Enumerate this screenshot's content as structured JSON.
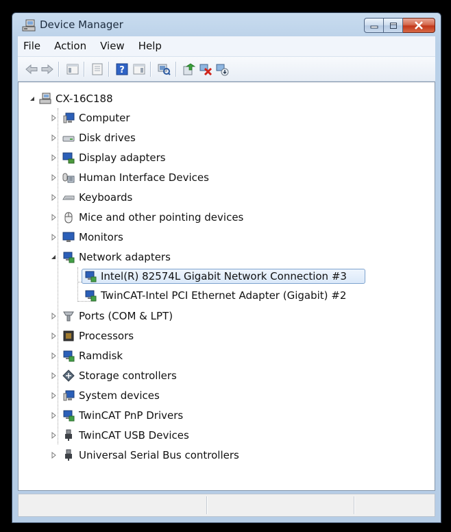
{
  "window": {
    "title": "Device Manager",
    "icon": "device-manager-icon"
  },
  "menu": [
    "File",
    "Action",
    "View",
    "Help"
  ],
  "toolbar": [
    "back-icon",
    "forward-icon",
    "show-hide-console-tree-icon",
    "properties-icon",
    "help-icon",
    "show-hide-action-pane-icon",
    "scan-hardware-changes-icon",
    "update-driver-icon",
    "uninstall-icon",
    "disable-icon"
  ],
  "tree": {
    "root": "CX-16C188",
    "categories": [
      {
        "label": "Computer",
        "icon": "computer-icon"
      },
      {
        "label": "Disk drives",
        "icon": "disk-drive-icon"
      },
      {
        "label": "Display adapters",
        "icon": "display-adapter-icon"
      },
      {
        "label": "Human Interface Devices",
        "icon": "hid-icon"
      },
      {
        "label": "Keyboards",
        "icon": "keyboard-icon"
      },
      {
        "label": "Mice and other pointing devices",
        "icon": "mouse-icon"
      },
      {
        "label": "Monitors",
        "icon": "monitor-icon"
      },
      {
        "label": "Network adapters",
        "icon": "network-adapter-icon"
      },
      {
        "label": "Ports (COM & LPT)",
        "icon": "port-icon"
      },
      {
        "label": "Processors",
        "icon": "processor-icon"
      },
      {
        "label": "Ramdisk",
        "icon": "ramdisk-icon"
      },
      {
        "label": "Storage controllers",
        "icon": "storage-controller-icon"
      },
      {
        "label": "System devices",
        "icon": "system-devices-icon"
      },
      {
        "label": "TwinCAT PnP Drivers",
        "icon": "twincat-pnp-icon"
      },
      {
        "label": "TwinCAT USB Devices",
        "icon": "usb-plug-icon"
      },
      {
        "label": "Universal Serial Bus controllers",
        "icon": "usb-plug-icon"
      }
    ],
    "network_adapters": [
      {
        "label": "Intel(R) 82574L Gigabit Network Connection #3",
        "selected": true
      },
      {
        "label": "TwinCAT-Intel PCI Ethernet Adapter (Gigabit) #2",
        "selected": false
      }
    ]
  },
  "colors": {
    "selection_border": "#7da2ce",
    "selection_fill": "#dbe9f9",
    "close_button": "#c2371b"
  }
}
